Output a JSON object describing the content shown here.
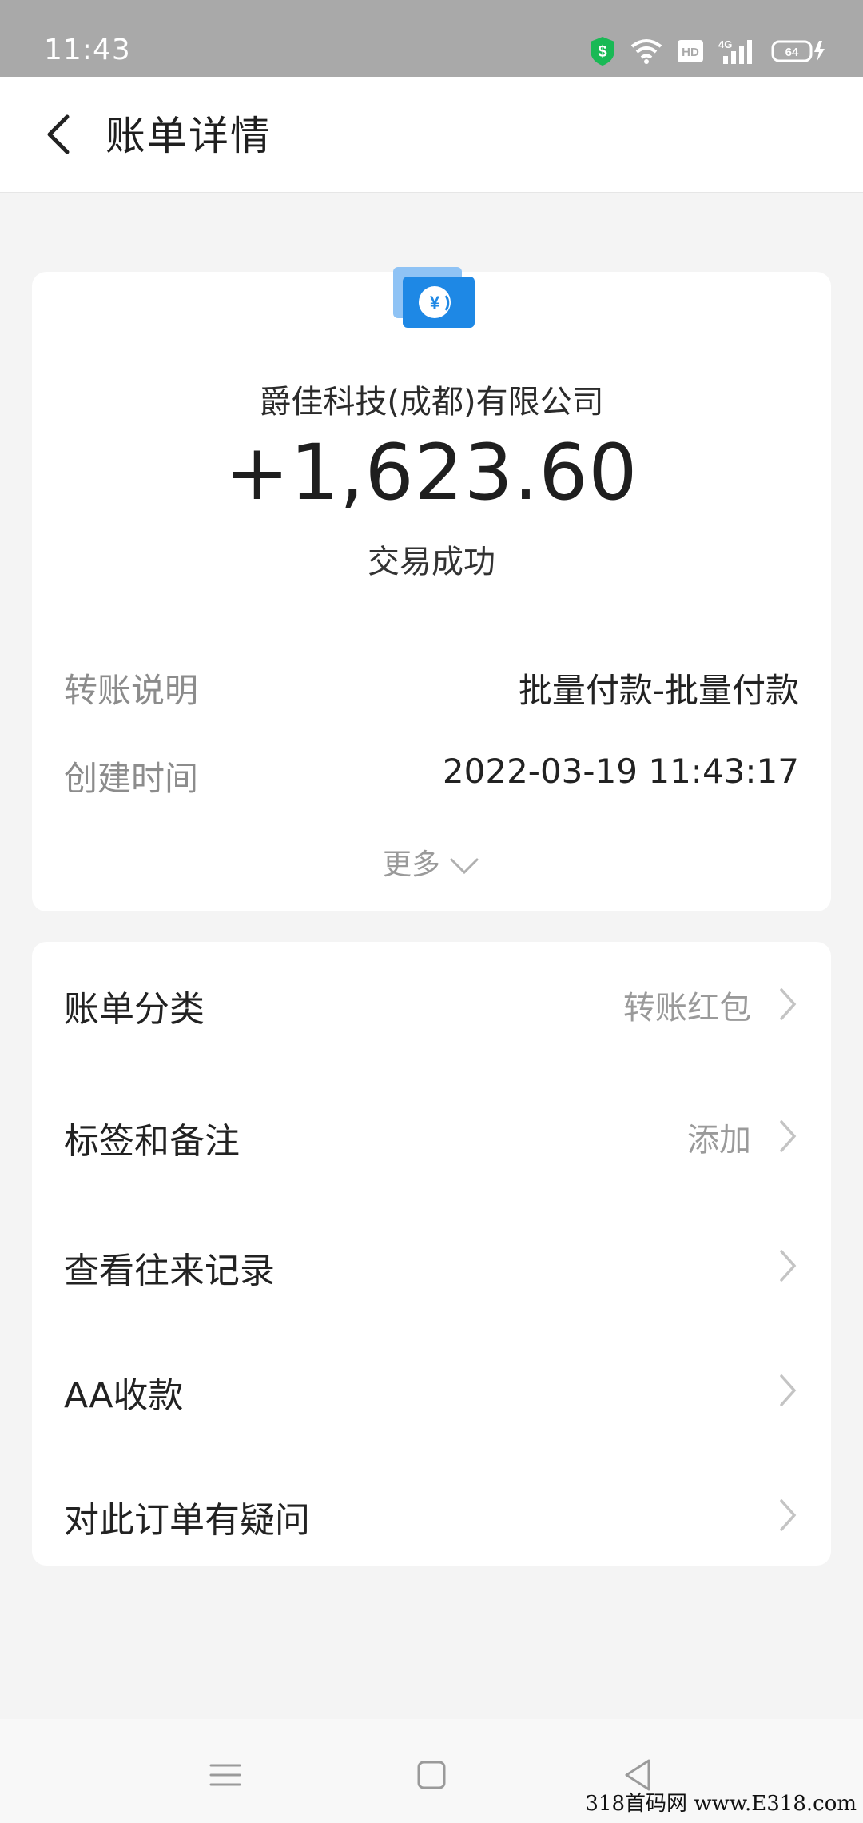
{
  "status_bar": {
    "time": "11:43",
    "hd": "HD",
    "network": "4G",
    "battery": "64"
  },
  "header": {
    "title": "账单详情"
  },
  "summary": {
    "payee": "爵佳科技(成都)有限公司",
    "amount": "+1,623.60",
    "status": "交易成功",
    "details": [
      {
        "label": "转账说明",
        "value": "批量付款-批量付款"
      },
      {
        "label": "创建时间",
        "value": "2022-03-19 11:43:17"
      }
    ],
    "more_label": "更多"
  },
  "menu": {
    "items": [
      {
        "label": "账单分类",
        "value": "转账红包"
      },
      {
        "label": "标签和备注",
        "value": "添加"
      },
      {
        "label": "查看往来记录",
        "value": ""
      },
      {
        "label": "AA收款",
        "value": ""
      },
      {
        "label": "对此订单有疑问",
        "value": ""
      }
    ]
  },
  "icons": {
    "back": "back-arrow-icon",
    "bill": "transfer-bill-icon",
    "chevron": "chevron-right-icon",
    "more": "chevron-down-icon"
  },
  "colors": {
    "statusbar": "#a9a9a9",
    "accent_blue": "#1677ff",
    "shield_green": "#19b955"
  },
  "watermark": "318首码网 www.E318.com"
}
